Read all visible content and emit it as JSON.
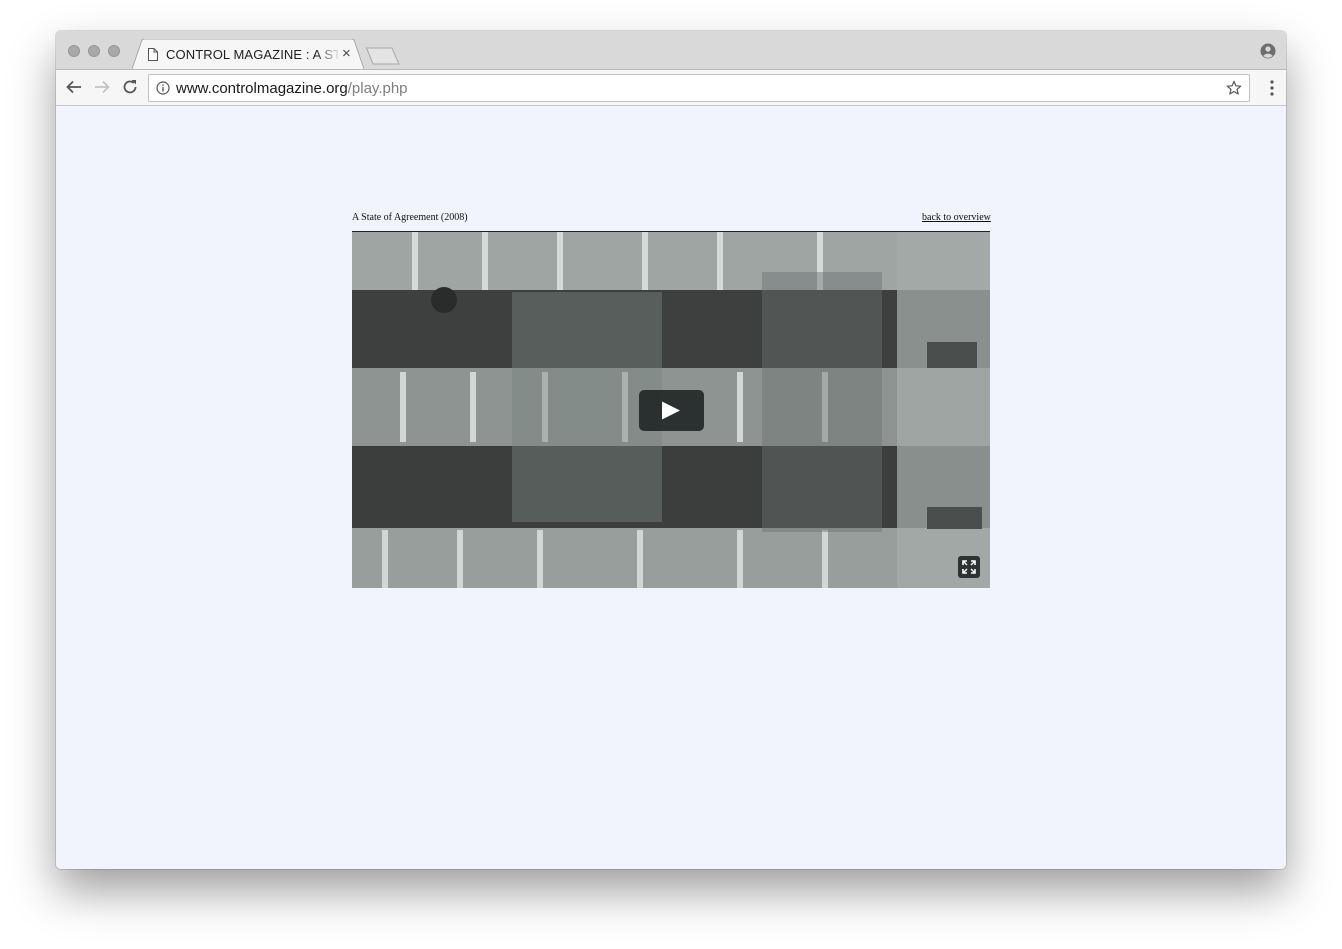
{
  "browser": {
    "tab": {
      "title": "CONTROL MAGAZINE : A STATE OF AGREEMENT",
      "close_glyph": "×",
      "icon": "document-icon"
    },
    "address_bar": {
      "host": "www.controlmagazine.org",
      "path": "/play.php",
      "icon": "info-icon"
    },
    "icons": [
      "back-arrow-icon",
      "forward-arrow-icon",
      "reload-icon",
      "star-icon",
      "menu-dots-icon",
      "profile-icon"
    ]
  },
  "page": {
    "video_title": "A State of Agreement (2008)",
    "back_link": "back to overview",
    "player": {
      "state": "paused",
      "controls": [
        "play-icon",
        "fullscreen-icon"
      ]
    }
  },
  "colors": {
    "page_background": "#f1f4fd",
    "tab_strip": "#d9d9d9",
    "toolbar": "#f6f6f6"
  }
}
